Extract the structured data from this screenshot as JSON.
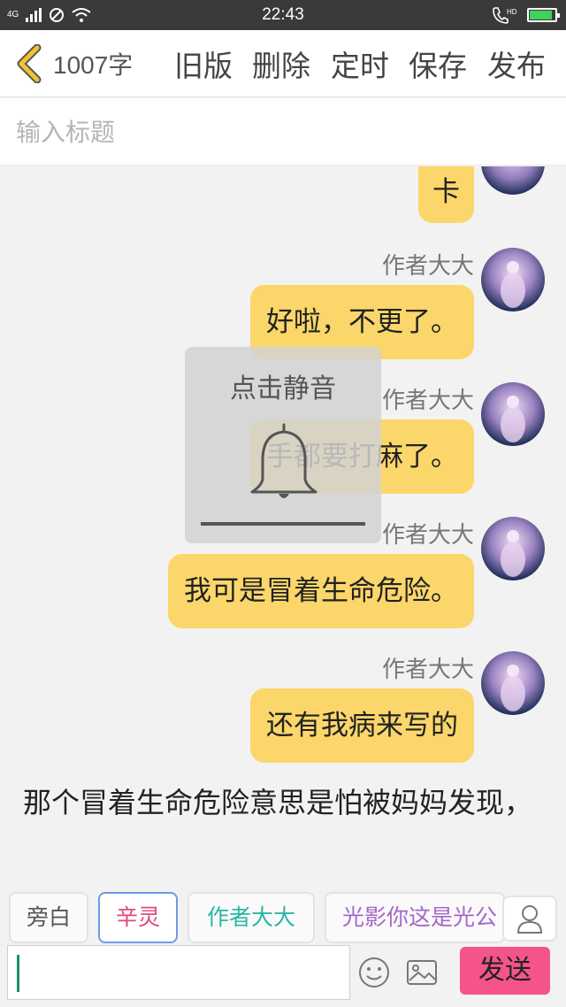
{
  "status_bar": {
    "network": "4G",
    "time": "22:43",
    "call_label": "HD",
    "battery_level": 0.9
  },
  "toolbar": {
    "word_count": "1007字",
    "buttons": {
      "old": "旧版",
      "delete": "删除",
      "timer": "定时",
      "save": "保存",
      "publish": "发布"
    }
  },
  "title": {
    "placeholder": "输入标题",
    "value": ""
  },
  "messages": [
    {
      "text": "卡"
    },
    {
      "name": "作者大大",
      "text": "好啦，不更了。"
    },
    {
      "name": "作者大大",
      "text": "手都要打麻了。"
    },
    {
      "name": "作者大大",
      "text": "我可是冒着生命危险。"
    },
    {
      "name": "作者大大",
      "text": "还有我病来写的"
    }
  ],
  "narration": "那个冒着生命危险意思是怕被妈妈发现，",
  "mute_popup": {
    "label": "点击静音"
  },
  "roles": [
    {
      "label": "旁白",
      "color": "#555555"
    },
    {
      "label": "辛灵",
      "color": "#e2477d"
    },
    {
      "label": "作者大大",
      "color": "#29b6a6"
    },
    {
      "label": "光影你这是光公",
      "color": "#a467c9"
    }
  ],
  "composer": {
    "value": "",
    "send_label": "发送"
  },
  "colors": {
    "bubble": "#fbd66a",
    "send": "#f5548a",
    "back_arrow": "#f2c230"
  }
}
